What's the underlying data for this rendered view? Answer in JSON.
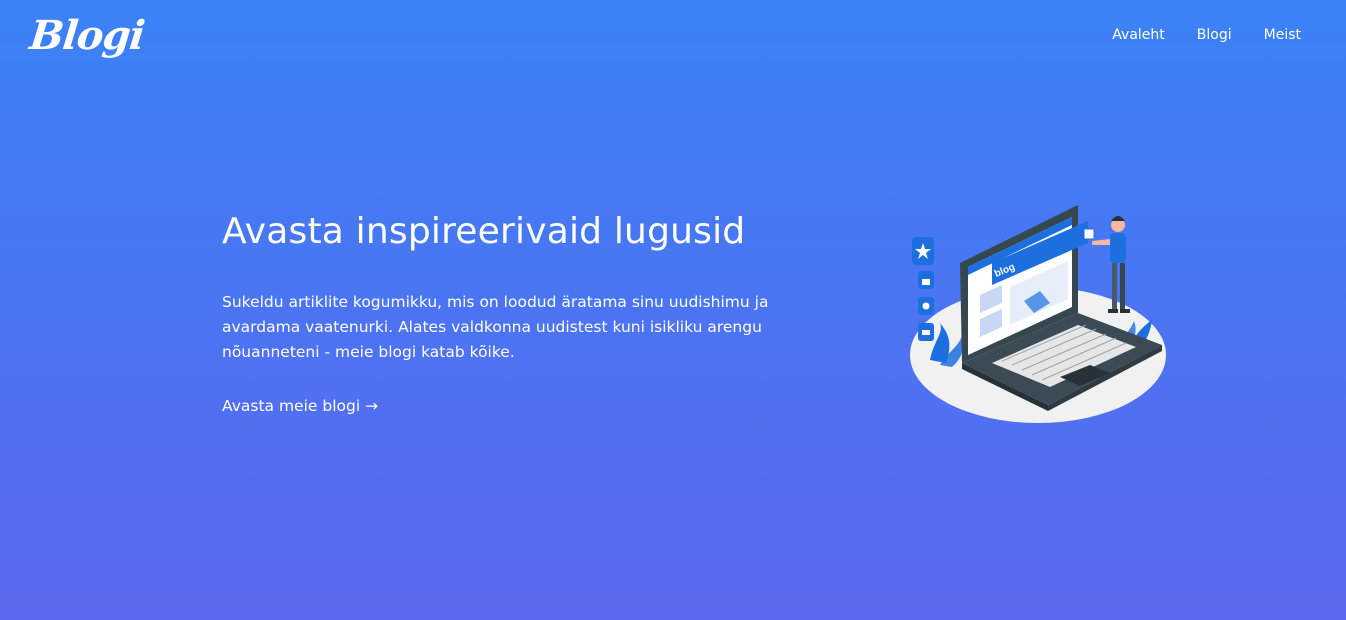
{
  "header": {
    "logo_text": "Blogi",
    "nav": [
      {
        "label": "Avaleht"
      },
      {
        "label": "Blogi"
      },
      {
        "label": "Meist"
      }
    ]
  },
  "hero": {
    "title": "Avasta inspireerivaid lugusid",
    "description": "Sukeldu artiklite kogumikku, mis on loodud äratama sinu uudishimu ja avardama vaatenurki. Alates valdkonna uudistest kuni isikliku arengu nõuanneteni - meie blogi katab kõike.",
    "cta": "Avasta meie blogi →",
    "illustration_label": "blog"
  },
  "colors": {
    "gradient_top": "#3b82f6",
    "gradient_bottom": "#5b67ee",
    "text": "#ffffff",
    "illustration_accent": "#1d6fe0"
  }
}
